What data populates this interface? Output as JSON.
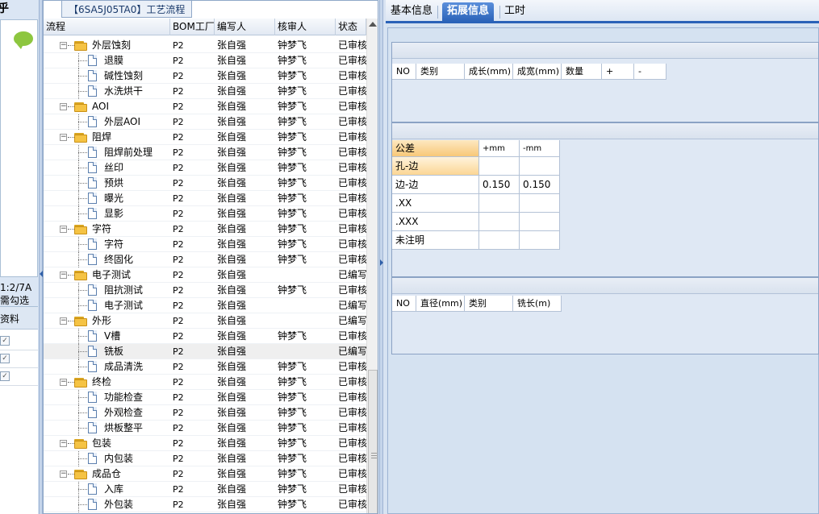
{
  "left_strip": {
    "top_char": "乎",
    "count_text": "1:2/7A",
    "hint_text": "需勾选",
    "column_header": "资料",
    "checkbox_mark": "✓"
  },
  "middle": {
    "title": "【6SA5J05TA0】工艺流程",
    "columns": [
      "流程",
      "BOM工厂",
      "编写人",
      "核审人",
      "状态"
    ],
    "rows": [
      {
        "level": 1,
        "type": "folder",
        "name": "外层蚀刻",
        "bom": "P2",
        "writer": "张自强",
        "reviewer": "钟梦飞",
        "status": "已审核"
      },
      {
        "level": 2,
        "type": "doc",
        "name": "退膜",
        "bom": "P2",
        "writer": "张自强",
        "reviewer": "钟梦飞",
        "status": "已审核"
      },
      {
        "level": 2,
        "type": "doc",
        "name": "碱性蚀刻",
        "bom": "P2",
        "writer": "张自强",
        "reviewer": "钟梦飞",
        "status": "已审核"
      },
      {
        "level": 2,
        "type": "doc",
        "name": "水洗烘干",
        "bom": "P2",
        "writer": "张自强",
        "reviewer": "钟梦飞",
        "status": "已审核"
      },
      {
        "level": 1,
        "type": "folder",
        "name": "AOI",
        "bom": "P2",
        "writer": "张自强",
        "reviewer": "钟梦飞",
        "status": "已审核"
      },
      {
        "level": 2,
        "type": "doc",
        "name": "外层AOI",
        "bom": "P2",
        "writer": "张自强",
        "reviewer": "钟梦飞",
        "status": "已审核"
      },
      {
        "level": 1,
        "type": "folder",
        "name": "阻焊",
        "bom": "P2",
        "writer": "张自强",
        "reviewer": "钟梦飞",
        "status": "已审核"
      },
      {
        "level": 2,
        "type": "doc",
        "name": "阻焊前处理",
        "bom": "P2",
        "writer": "张自强",
        "reviewer": "钟梦飞",
        "status": "已审核"
      },
      {
        "level": 2,
        "type": "doc",
        "name": "丝印",
        "bom": "P2",
        "writer": "张自强",
        "reviewer": "钟梦飞",
        "status": "已审核"
      },
      {
        "level": 2,
        "type": "doc",
        "name": "预烘",
        "bom": "P2",
        "writer": "张自强",
        "reviewer": "钟梦飞",
        "status": "已审核"
      },
      {
        "level": 2,
        "type": "doc",
        "name": "曝光",
        "bom": "P2",
        "writer": "张自强",
        "reviewer": "钟梦飞",
        "status": "已审核"
      },
      {
        "level": 2,
        "type": "doc",
        "name": "显影",
        "bom": "P2",
        "writer": "张自强",
        "reviewer": "钟梦飞",
        "status": "已审核"
      },
      {
        "level": 1,
        "type": "folder",
        "name": "字符",
        "bom": "P2",
        "writer": "张自强",
        "reviewer": "钟梦飞",
        "status": "已审核"
      },
      {
        "level": 2,
        "type": "doc",
        "name": "字符",
        "bom": "P2",
        "writer": "张自强",
        "reviewer": "钟梦飞",
        "status": "已审核"
      },
      {
        "level": 2,
        "type": "doc",
        "name": "终固化",
        "bom": "P2",
        "writer": "张自强",
        "reviewer": "钟梦飞",
        "status": "已审核"
      },
      {
        "level": 1,
        "type": "folder",
        "name": "电子测试",
        "bom": "P2",
        "writer": "张自强",
        "reviewer": "",
        "status": "已编写"
      },
      {
        "level": 2,
        "type": "doc",
        "name": "阻抗测试",
        "bom": "P2",
        "writer": "张自强",
        "reviewer": "钟梦飞",
        "status": "已审核"
      },
      {
        "level": 2,
        "type": "doc",
        "name": "电子测试",
        "bom": "P2",
        "writer": "张自强",
        "reviewer": "",
        "status": "已编写"
      },
      {
        "level": 1,
        "type": "folder",
        "name": "外形",
        "bom": "P2",
        "writer": "张自强",
        "reviewer": "",
        "status": "已编写"
      },
      {
        "level": 2,
        "type": "doc",
        "name": "V槽",
        "bom": "P2",
        "writer": "张自强",
        "reviewer": "钟梦飞",
        "status": "已审核"
      },
      {
        "level": 2,
        "type": "doc",
        "name": "铣板",
        "bom": "P2",
        "writer": "张自强",
        "reviewer": "",
        "status": "已编写",
        "selected": true
      },
      {
        "level": 2,
        "type": "doc",
        "name": "成品清洗",
        "bom": "P2",
        "writer": "张自强",
        "reviewer": "钟梦飞",
        "status": "已审核"
      },
      {
        "level": 1,
        "type": "folder",
        "name": "终检",
        "bom": "P2",
        "writer": "张自强",
        "reviewer": "钟梦飞",
        "status": "已审核"
      },
      {
        "level": 2,
        "type": "doc",
        "name": "功能检查",
        "bom": "P2",
        "writer": "张自强",
        "reviewer": "钟梦飞",
        "status": "已审核"
      },
      {
        "level": 2,
        "type": "doc",
        "name": "外观检查",
        "bom": "P2",
        "writer": "张自强",
        "reviewer": "钟梦飞",
        "status": "已审核"
      },
      {
        "level": 2,
        "type": "doc",
        "name": "烘板整平",
        "bom": "P2",
        "writer": "张自强",
        "reviewer": "钟梦飞",
        "status": "已审核"
      },
      {
        "level": 1,
        "type": "folder",
        "name": "包装",
        "bom": "P2",
        "writer": "张自强",
        "reviewer": "钟梦飞",
        "status": "已审核"
      },
      {
        "level": 2,
        "type": "doc",
        "name": "内包装",
        "bom": "P2",
        "writer": "张自强",
        "reviewer": "钟梦飞",
        "status": "已审核"
      },
      {
        "level": 1,
        "type": "folder",
        "name": "成品仓",
        "bom": "P2",
        "writer": "张自强",
        "reviewer": "钟梦飞",
        "status": "已审核"
      },
      {
        "level": 2,
        "type": "doc",
        "name": "入库",
        "bom": "P2",
        "writer": "张自强",
        "reviewer": "钟梦飞",
        "status": "已审核"
      },
      {
        "level": 2,
        "type": "doc",
        "name": "外包装",
        "bom": "P2",
        "writer": "张自强",
        "reviewer": "钟梦飞",
        "status": "已审核"
      }
    ]
  },
  "right": {
    "tabs": [
      "基本信息",
      "拓展信息",
      "工时"
    ],
    "active_tab": 1,
    "grid1_headers": [
      "NO",
      "类别",
      "成长(mm)",
      "成宽(mm)",
      "数量",
      "+",
      "-"
    ],
    "tolerance": {
      "headers": [
        "公差",
        "+mm",
        "-mm"
      ],
      "rows": [
        {
          "label": "孔-边",
          "plus": "",
          "minus": ""
        },
        {
          "label": "边-边",
          "plus": "0.150",
          "minus": "0.150"
        },
        {
          "label": ".XX",
          "plus": "",
          "minus": ""
        },
        {
          "label": ".XXX",
          "plus": "",
          "minus": ""
        },
        {
          "label": "未注明",
          "plus": "",
          "minus": ""
        }
      ]
    },
    "grid3_headers": [
      "NO",
      "直径(mm)",
      "类别",
      "铣长(m)"
    ]
  },
  "colors": {
    "accent": "#2a62b8",
    "folder": "#f5c344",
    "highlight": "#f8c878"
  }
}
